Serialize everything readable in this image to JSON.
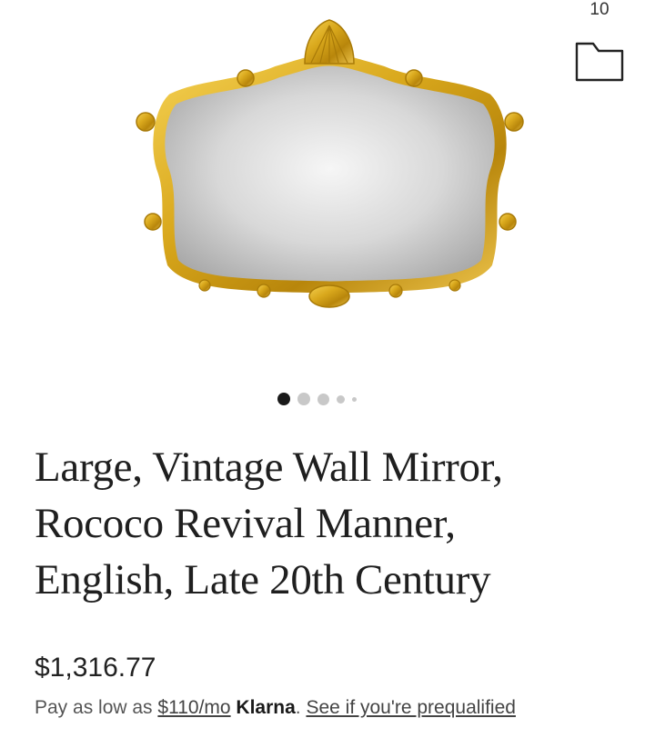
{
  "header": {
    "favorites_count": "10",
    "folder_icon": "folder-icon"
  },
  "gallery": {
    "image_icon": "ornate-gilt-mirror-image",
    "slides_total": 5,
    "active_slide": 1
  },
  "product": {
    "title_lines": [
      "Large, Vintage Wall Mirror,",
      "Rococo Revival Manner,",
      "English, Late 20th Century"
    ],
    "price": "$1,316.77"
  },
  "financing": {
    "prefix": "Pay as low as ",
    "monthly": "$110/mo",
    "brand": "Klarna",
    "separator": ". ",
    "prequal_link": "See if you're prequalified"
  },
  "colors": {
    "gold": "#d9a81c",
    "dot_active": "#1a1a1a",
    "dot_inactive": "#c8c8c8"
  }
}
